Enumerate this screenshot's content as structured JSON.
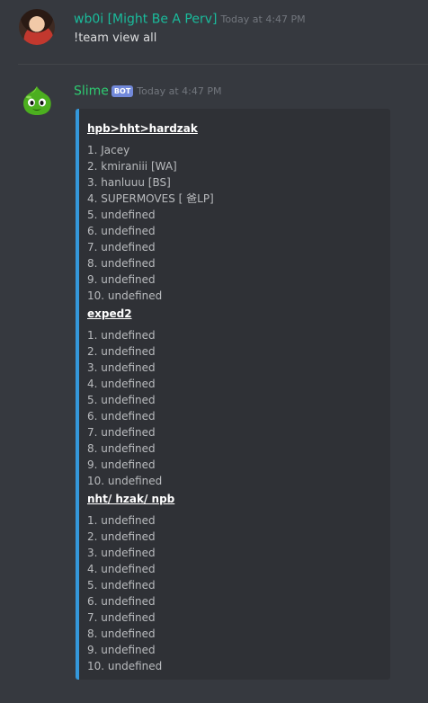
{
  "messages": [
    {
      "username": "wb0i [Might Be A Perv]",
      "timestamp": "Today at 4:47 PM",
      "content": "!team view all"
    },
    {
      "username": "Slime",
      "bot_tag": "BOT",
      "timestamp": "Today at 4:47 PM",
      "embed": {
        "accent_color": "#3498db",
        "fields": [
          {
            "name": "hpb>hht>hardzak",
            "lines": [
              "1. Jacey",
              "2. kmiraniii [WA]",
              "3. hanluuu [BS]",
              "4. SUPERMOVES [ 爸LP]",
              "5. undefined",
              "6. undefined",
              "7. undefined",
              "8. undefined",
              "9. undefined",
              "10. undefined"
            ]
          },
          {
            "name": "exped2",
            "lines": [
              "1. undefined",
              "2. undefined",
              "3. undefined",
              "4. undefined",
              "5. undefined",
              "6. undefined",
              "7. undefined",
              "8. undefined",
              "9. undefined",
              "10. undefined"
            ]
          },
          {
            "name": "nht/ hzak/ npb",
            "lines": [
              "1. undefined",
              "2. undefined",
              "3. undefined",
              "4. undefined",
              "5. undefined",
              "6. undefined",
              "7. undefined",
              "8. undefined",
              "9. undefined",
              "10. undefined"
            ]
          }
        ]
      }
    }
  ],
  "colors": {
    "background": "#36393f",
    "embed_background": "#2f3136",
    "username_wb0i": "#1abc9c",
    "username_slime": "#2ecc71",
    "bot_tag": "#7289da"
  },
  "icons": {
    "user_avatar": "user-avatar-photo",
    "bot_avatar": "slime-avatar"
  }
}
